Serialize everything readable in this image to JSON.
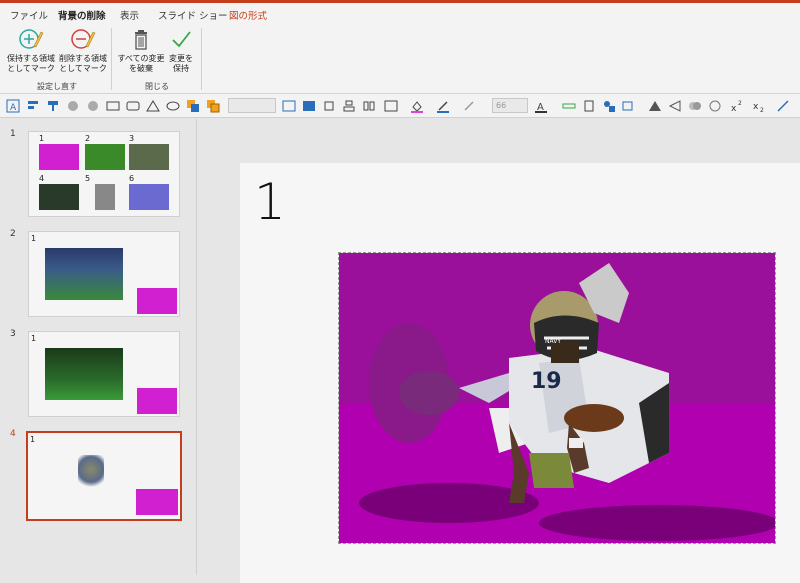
{
  "tabs": [
    {
      "label": "ファイル",
      "state": "normal"
    },
    {
      "label": "背景の削除",
      "state": "active"
    },
    {
      "label": "表示",
      "state": "normal"
    },
    {
      "label": "スライド ショー",
      "state": "normal"
    },
    {
      "label": "図の形式",
      "state": "context"
    }
  ],
  "ribbon": {
    "keep_line1": "保持する領域",
    "keep_line2": "としてマーク",
    "remove_line1": "削除する領域",
    "remove_line2": "としてマーク",
    "group_refine": "設定し直す",
    "discard_line1": "すべての変更",
    "discard_line2": "を破棄",
    "save_line1": "変更を",
    "save_line2": "保持",
    "group_close": "閉じる"
  },
  "toolbar": {
    "font_size": "66"
  },
  "slides": [
    {
      "num": "1",
      "labels": [
        "1",
        "2",
        "3",
        "4",
        "5",
        "6"
      ]
    },
    {
      "num": "2",
      "label": "1"
    },
    {
      "num": "3",
      "label": "1"
    },
    {
      "num": "4",
      "label": "1"
    }
  ],
  "main_slide": {
    "title": "1"
  },
  "colors": {
    "accent": "#c43e1c",
    "magenta": "#b000b0"
  }
}
